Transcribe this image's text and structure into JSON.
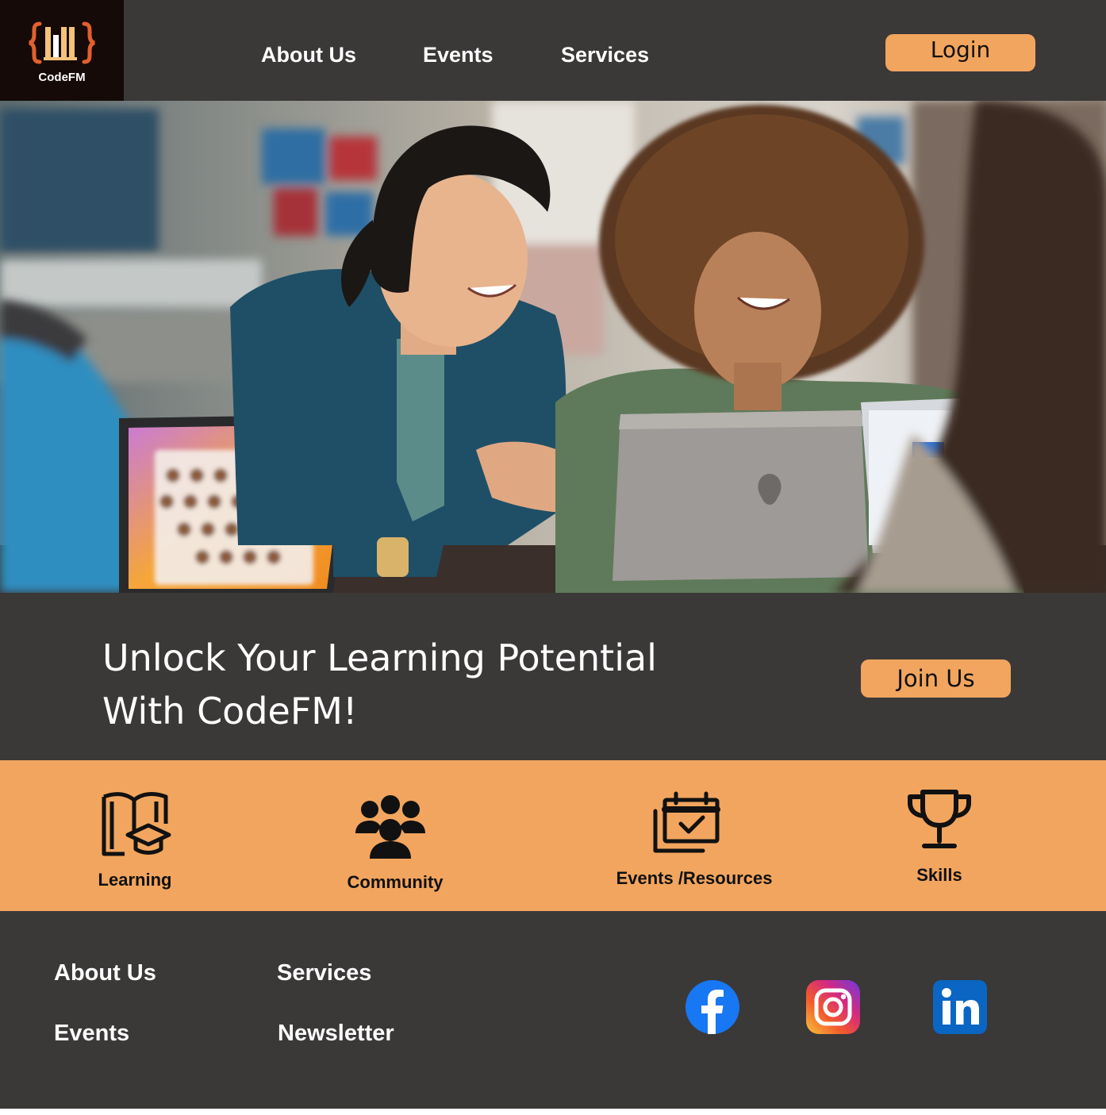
{
  "brand": {
    "name": "CodeFM"
  },
  "nav": {
    "about": "About Us",
    "events": "Events",
    "services": "Services",
    "login": "Login"
  },
  "hero": {
    "headline_line1": "Unlock Your Learning Potential",
    "headline_line2": "With CodeFM!",
    "cta": "Join Us"
  },
  "features": {
    "learning": {
      "label": "Learning",
      "icon": "book-graduation-cap-icon"
    },
    "community": {
      "label": "Community",
      "icon": "people-group-icon"
    },
    "events": {
      "label": "Events /Resources",
      "icon": "calendar-check-icon"
    },
    "skills": {
      "label": "Skills",
      "icon": "trophy-icon"
    }
  },
  "footer": {
    "about": "About Us",
    "services": "Services",
    "events": "Events",
    "newsletter": "Newsletter",
    "social": [
      "facebook-icon",
      "instagram-icon",
      "linkedin-icon"
    ]
  },
  "colors": {
    "dark": "#3b3838",
    "logo_bg": "#150a07",
    "accent": "#f2a55e"
  }
}
